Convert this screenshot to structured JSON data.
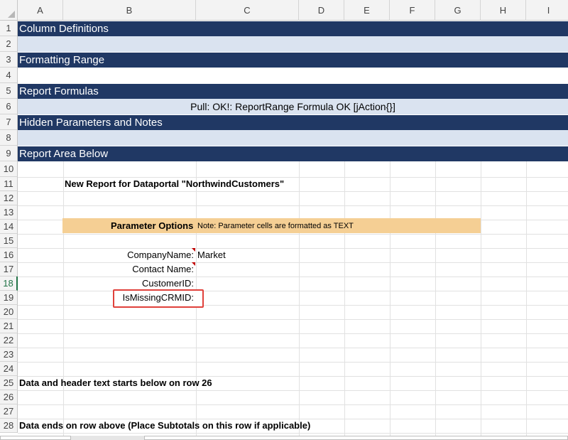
{
  "columns": [
    "A",
    "B",
    "C",
    "D",
    "E",
    "F",
    "G",
    "H",
    "I"
  ],
  "rows": [
    "1",
    "2",
    "3",
    "4",
    "5",
    "6",
    "7",
    "8",
    "9",
    "10",
    "11",
    "12",
    "13",
    "14",
    "15",
    "16",
    "17",
    "18",
    "19",
    "20",
    "21",
    "22",
    "23",
    "24",
    "25",
    "26",
    "27",
    "28"
  ],
  "selected_row": "18",
  "sections": {
    "column_definitions": "Column Definitions",
    "formatting_range": "Formatting Range",
    "report_formulas": "Report Formulas",
    "formula_status": "Pull: OK!: ReportRange Formula OK [jAction{}]",
    "hidden_parameters": "Hidden Parameters and Notes",
    "report_area": "Report Area Below"
  },
  "report_title": "New Report for Dataportal \"NorthwindCustomers\"",
  "parameter_options": {
    "title": "Parameter Options",
    "note": "Note: Parameter cells are formatted as TEXT"
  },
  "parameters": [
    {
      "label": "CompanyName:",
      "value": "Market"
    },
    {
      "label": "Contact Name:",
      "value": ""
    },
    {
      "label": "CustomerID:",
      "value": ""
    },
    {
      "label": "IsMissingCRMID:",
      "value": ""
    }
  ],
  "notes": {
    "data_start": "Data and header text starts below on row 26",
    "data_end": "Data ends on row above (Place Subtotals on this row if applicable)"
  },
  "colors": {
    "section_band": "#203864",
    "light_band": "#dae3f0",
    "parameter_bar": "#f5cf94",
    "highlight": "#e0413b",
    "selected_row": "#217346"
  }
}
